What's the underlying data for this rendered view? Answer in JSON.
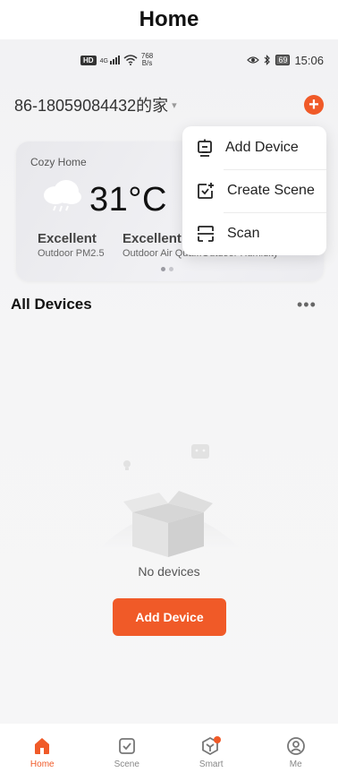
{
  "caption": "Home",
  "status_bar": {
    "hd_badge": "HD",
    "signal_label": "4G",
    "net_rate_value": "768",
    "net_rate_unit": "B/s",
    "battery": "69",
    "time": "15:06"
  },
  "header": {
    "home_name": "86-18059084432的家",
    "caret": "▾",
    "add_symbol": "+"
  },
  "weather": {
    "location": "Cozy Home",
    "temperature": "31°C",
    "metrics": [
      {
        "value": "Excellent",
        "label": "Outdoor PM2.5"
      },
      {
        "value": "Excellent",
        "label": "Outdoor Air Qua...Outdoor Humidity"
      }
    ],
    "active_page": 1,
    "page_count": 2
  },
  "dropdown_menu": {
    "items": [
      {
        "label": "Add Device",
        "icon": "add-device-icon"
      },
      {
        "label": "Create Scene",
        "icon": "create-scene-icon"
      },
      {
        "label": "Scan",
        "icon": "scan-icon"
      }
    ]
  },
  "devices_section": {
    "title": "All Devices",
    "more": "•••",
    "empty_text": "No devices",
    "add_button_label": "Add Device"
  },
  "tab_bar": {
    "tabs": [
      {
        "label": "Home",
        "icon": "home-icon",
        "active": true
      },
      {
        "label": "Scene",
        "icon": "scene-icon",
        "active": false
      },
      {
        "label": "Smart",
        "icon": "smart-icon",
        "active": false
      },
      {
        "label": "Me",
        "icon": "me-icon",
        "active": false
      }
    ]
  },
  "colors": {
    "accent": "#f05a28",
    "inactive_tab": "#888888"
  }
}
